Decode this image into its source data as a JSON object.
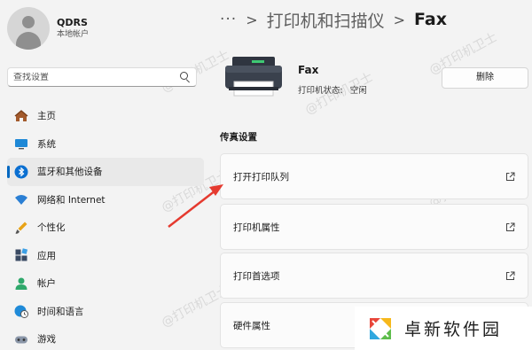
{
  "user": {
    "name": "QDRS",
    "account_type": "本地帐户"
  },
  "search": {
    "placeholder": "查找设置"
  },
  "nav": {
    "items": [
      {
        "label": "主页",
        "icon": "home-icon"
      },
      {
        "label": "系统",
        "icon": "monitor-icon"
      },
      {
        "label": "蓝牙和其他设备",
        "icon": "bluetooth-icon",
        "active": true
      },
      {
        "label": "网络和 Internet",
        "icon": "wifi-icon"
      },
      {
        "label": "个性化",
        "icon": "brush-icon"
      },
      {
        "label": "应用",
        "icon": "apps-icon"
      },
      {
        "label": "帐户",
        "icon": "person-icon"
      },
      {
        "label": "时间和语言",
        "icon": "globe-clock-icon"
      },
      {
        "label": "游戏",
        "icon": "gamepad-icon"
      }
    ]
  },
  "breadcrumb": {
    "more": "···",
    "parent": "打印机和扫描仪",
    "separator": ">",
    "current": "Fax"
  },
  "device": {
    "name": "Fax",
    "status_label": "打印机状态:",
    "status_value": "空闲",
    "icon": "printer-icon"
  },
  "actions": {
    "delete_label": "删除"
  },
  "section": {
    "title": "传真设置"
  },
  "settings": [
    {
      "label": "打开打印队列",
      "icon": "open-external-icon"
    },
    {
      "label": "打印机属性",
      "icon": "open-external-icon"
    },
    {
      "label": "打印首选项",
      "icon": "open-external-icon"
    },
    {
      "label": "硬件属性",
      "icon": "open-external-icon"
    }
  ],
  "watermark": {
    "text": "@打印机卫士"
  },
  "brand": {
    "text": "卓新软件园",
    "colors": [
      "#e8463a",
      "#f6b81c",
      "#2fa7df",
      "#5ebd4c"
    ]
  },
  "colors": {
    "accent": "#0067c0",
    "annotation_arrow": "#e53a2f"
  }
}
